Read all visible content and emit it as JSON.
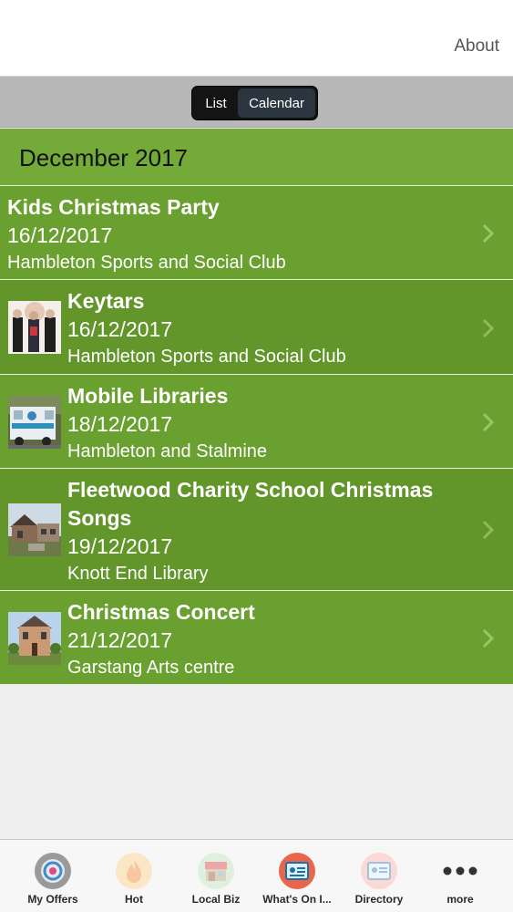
{
  "header": {
    "about_label": "About"
  },
  "segmented": {
    "list_label": "List",
    "calendar_label": "Calendar",
    "selected": "List"
  },
  "month": {
    "label": "December 2017"
  },
  "events": [
    {
      "name": "Kids Christmas Party",
      "date": "16/12/2017",
      "venue": "Hambleton Sports and Social Club",
      "has_image": false
    },
    {
      "name": "Keytars",
      "date": "16/12/2017",
      "venue": "Hambleton Sports and Social Club",
      "has_image": true
    },
    {
      "name": "Mobile Libraries",
      "date": "18/12/2017",
      "venue": "Hambleton and Stalmine",
      "has_image": true
    },
    {
      "name": "Fleetwood Charity School Christmas Songs",
      "date": "19/12/2017",
      "venue": "Knott End Library",
      "has_image": true
    },
    {
      "name": "Christmas Concert",
      "date": "21/12/2017",
      "venue": "Garstang Arts centre",
      "has_image": true
    }
  ],
  "tabs": [
    {
      "label": "My Offers",
      "icon": "offers-icon"
    },
    {
      "label": "Hot",
      "icon": "flame-icon"
    },
    {
      "label": "Local Biz",
      "icon": "shop-icon"
    },
    {
      "label": "What's On I...",
      "icon": "whats-on-icon"
    },
    {
      "label": "Directory",
      "icon": "directory-icon"
    },
    {
      "label": "more",
      "icon": "more-icon"
    }
  ],
  "colors": {
    "accent_green": "#6aa030",
    "accent_green_dark": "#62952a",
    "segment_bg": "#141414"
  }
}
